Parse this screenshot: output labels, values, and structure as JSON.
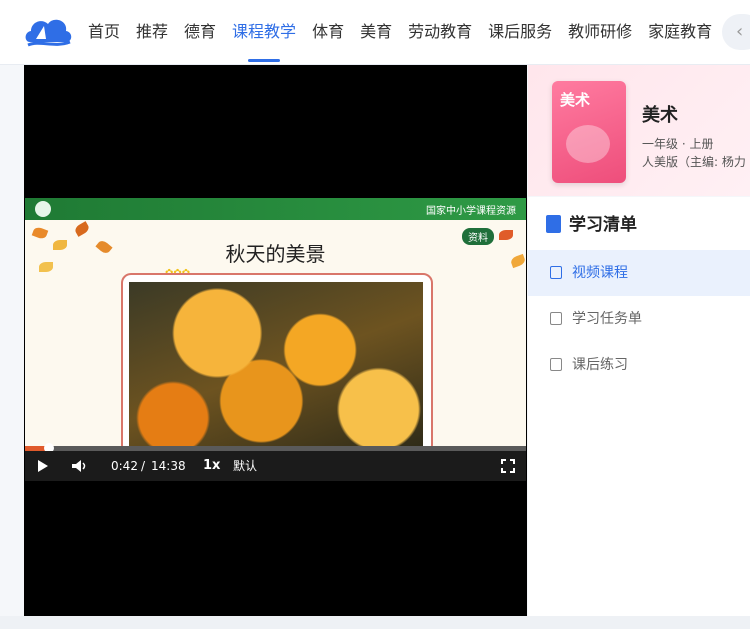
{
  "nav": {
    "items": [
      "首页",
      "推荐",
      "德育",
      "课程教学",
      "体育",
      "美育",
      "劳动教育",
      "课后服务",
      "教师研修",
      "家庭教育"
    ],
    "active_index": 3,
    "prev_icon": "‹"
  },
  "player": {
    "slide_brand": "国家中小学课程资源",
    "slide_title": "秋天的美景",
    "slide_tag": "资料",
    "current_time": "0:42",
    "time_sep": "/",
    "duration": "14:38",
    "speed": "1x",
    "quality": "默认",
    "progress": 0.048
  },
  "course": {
    "cover_title": "美术",
    "name": "美术",
    "grade": "一年级 · 上册",
    "edition": "人美版（主编: 杨力"
  },
  "study": {
    "title": "学习清单",
    "items": [
      {
        "label": "视频课程",
        "active": true
      },
      {
        "label": "学习任务单",
        "active": false
      },
      {
        "label": "课后练习",
        "active": false
      }
    ]
  },
  "colors": {
    "accent": "#2f6ee6",
    "brand_green": "#1f7a34"
  }
}
